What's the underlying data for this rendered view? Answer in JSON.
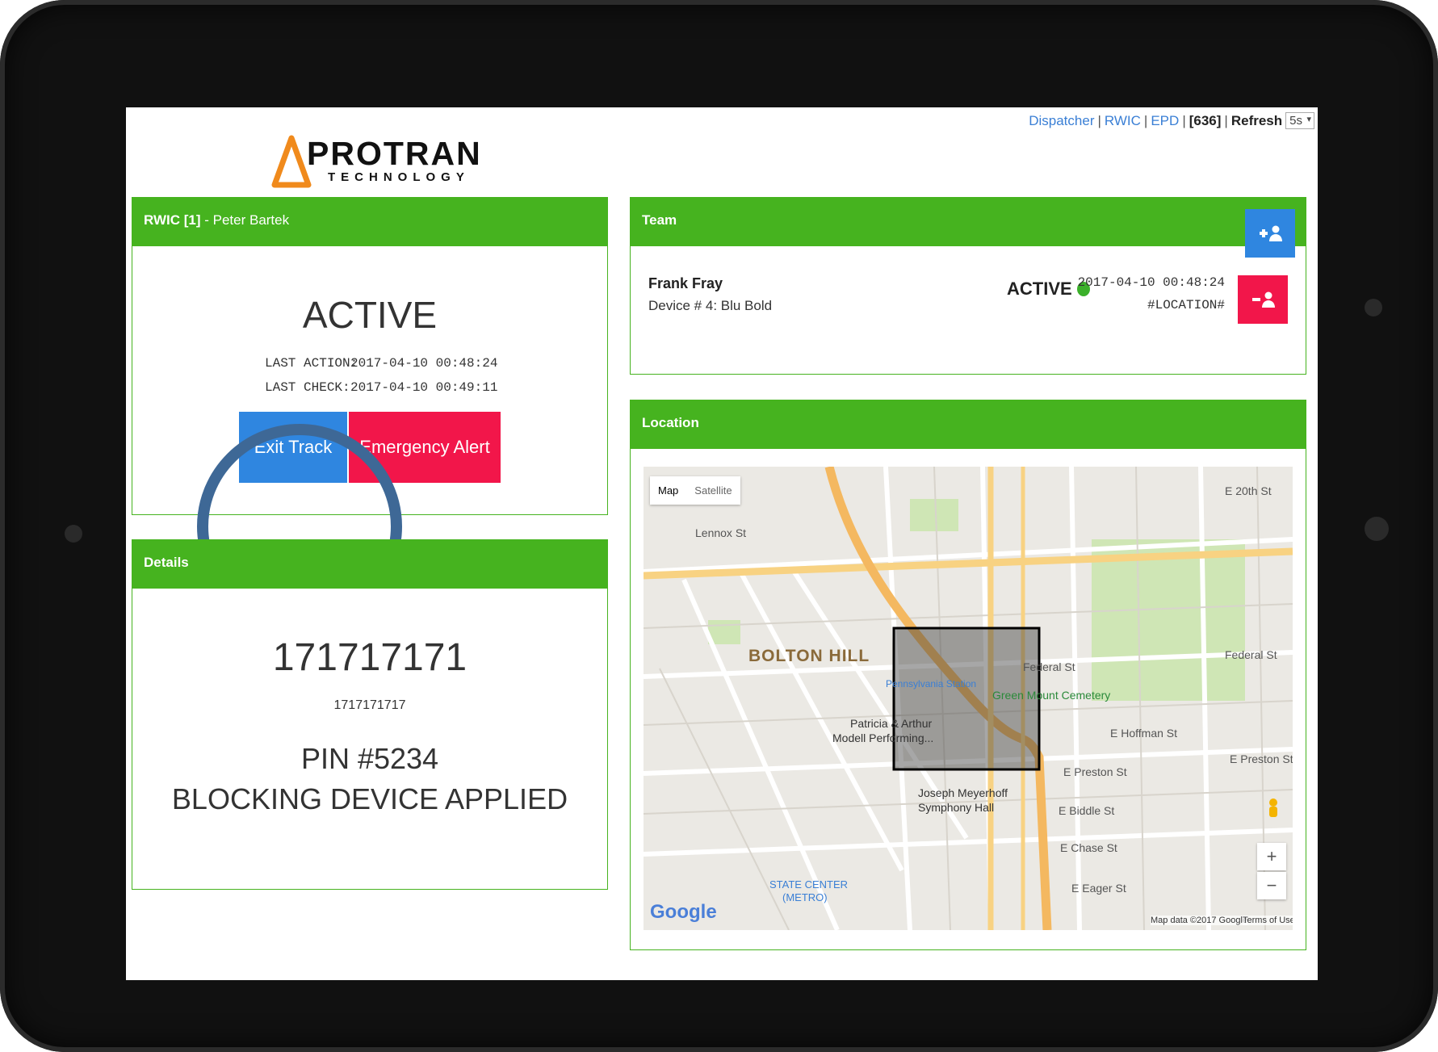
{
  "topnav": {
    "links": [
      "Dispatcher",
      "RWIC",
      "EPD"
    ],
    "count": "[636]",
    "refresh_label": "Refresh",
    "refresh_value": "5s"
  },
  "logo": {
    "word": "PROTRAN",
    "sub": "TECHNOLOGY"
  },
  "rwic": {
    "title_bold": "RWIC [1]",
    "title_rest": " - Peter Bartek",
    "status": "ACTIVE",
    "last_action_label": "LAST ACTION:",
    "last_action_value": "2017-04-10 00:48:24",
    "last_check_label": "LAST CHECK:",
    "last_check_value": "2017-04-10 00:49:11",
    "exit_label": "Exit Track",
    "emergency_label": "Emergency Alert"
  },
  "details": {
    "title": "Details",
    "id_big": "171717171",
    "id_small": "1717171717",
    "pin": "PIN #5234",
    "blocking": "BLOCKING DEVICE APPLIED"
  },
  "team": {
    "title": "Team",
    "member": {
      "name": "Frank Fray",
      "device": "Device # 4: Blu Bold",
      "status": "ACTIVE",
      "time": "2017-04-10 00:48:24",
      "location": "#LOCATION#"
    }
  },
  "location": {
    "title": "Location",
    "map_tabs": [
      "Map",
      "Satellite"
    ],
    "labels": {
      "bolton": "BOLTON HILL",
      "penn": "Pennsylvania Station",
      "cemetery": "Green Mount Cemetery",
      "modell": "Patricia & Arthur",
      "modell2": "Modell Performing...",
      "meyer": "Joseph Meyerhoff",
      "meyer2": "Symphony Hall",
      "state": "STATE CENTER",
      "state2": "(METRO)",
      "lennox": "Lennox St",
      "preston": "E Preston St",
      "biddle": "E Biddle St",
      "chase": "E Chase St",
      "eager": "E Eager St",
      "hoffman": "E Hoffman St",
      "federal": "Federal St",
      "federal2": "Federal St",
      "preston2": "E Preston St",
      "twentieth": "E 20th St",
      "google": "Google",
      "mapdata": "Map data ©2017 Google",
      "terms": "Terms of Use"
    },
    "zoom_in": "+",
    "zoom_out": "−"
  },
  "colors": {
    "green": "#46b31f",
    "blue": "#2f86e0",
    "red": "#f2164a",
    "circle": "#3e6896"
  }
}
